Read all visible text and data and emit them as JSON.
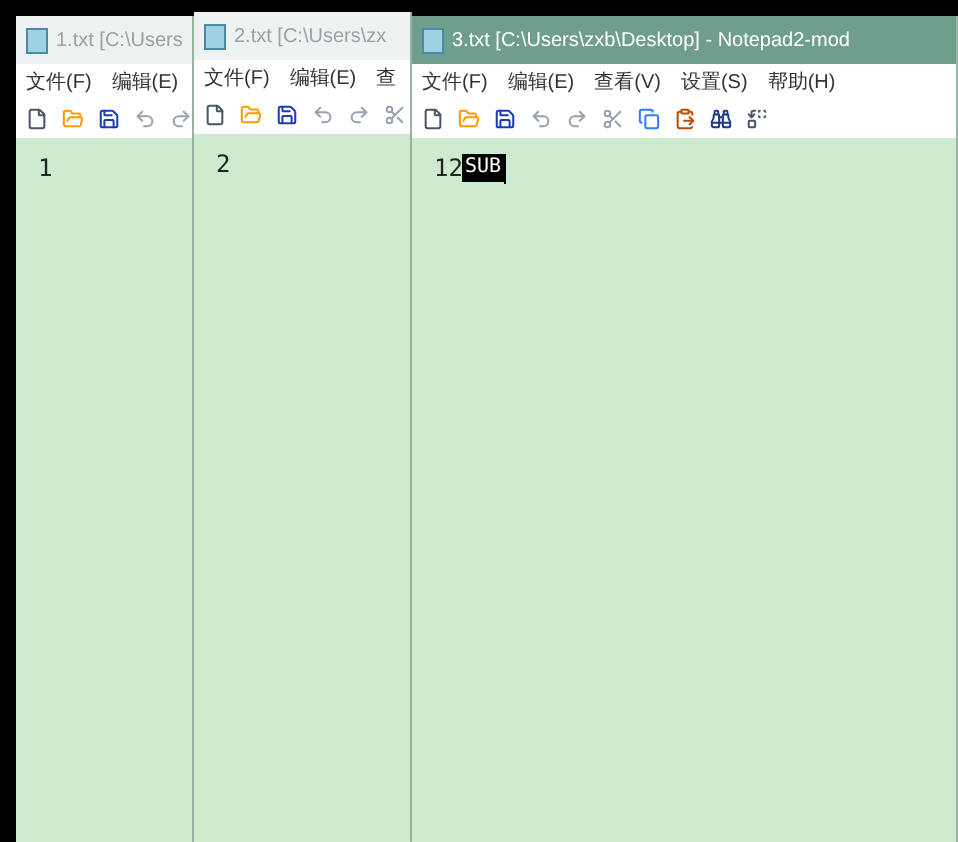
{
  "windows": [
    {
      "title": "1.txt [C:\\Users",
      "active": false,
      "menu": [
        "文件(F)",
        "编辑(E)"
      ],
      "editor": {
        "text": "1"
      }
    },
    {
      "title": "2.txt [C:\\Users\\zx",
      "active": false,
      "menu": [
        "文件(F)",
        "编辑(E)",
        "查"
      ],
      "editor": {
        "text": "2"
      }
    },
    {
      "title": "3.txt [C:\\Users\\zxb\\Desktop] - Notepad2-mod",
      "active": true,
      "menu": [
        "文件(F)",
        "编辑(E)",
        "查看(V)",
        "设置(S)",
        "帮助(H)"
      ],
      "editor": {
        "text": "12",
        "selection": "SUB"
      }
    }
  ]
}
